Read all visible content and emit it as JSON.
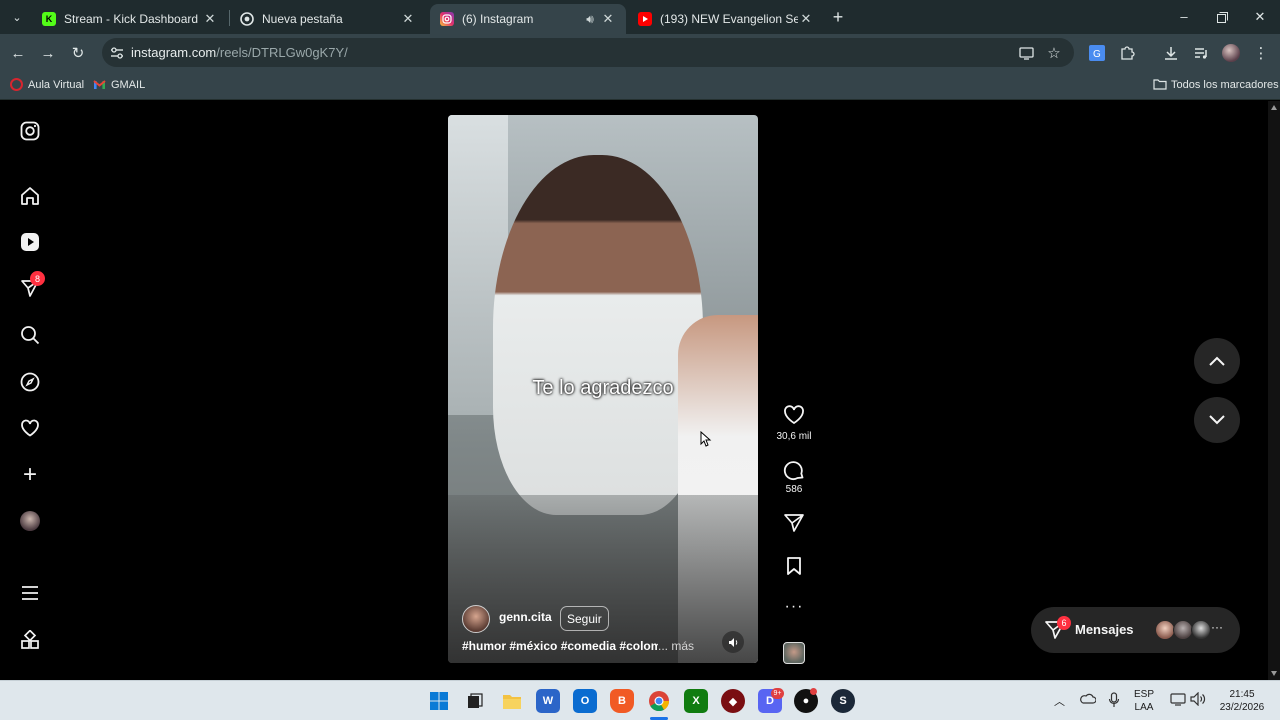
{
  "browser": {
    "tabs": [
      {
        "title": "Stream - Kick Dashboard",
        "favicon": "kick-icon",
        "active": false
      },
      {
        "title": "Nueva pestaña",
        "favicon": "chrome-icon",
        "active": false
      },
      {
        "title": "(6) Instagram",
        "favicon": "instagram-icon",
        "active": true,
        "audio": true
      },
      {
        "title": "(193) NEW Evangelion Series Ar",
        "favicon": "youtube-icon",
        "active": false
      }
    ],
    "url_domain": "instagram.com",
    "url_path": "/reels/DTRLGw0gK7Y/",
    "bookmarks": [
      {
        "label": "Aula Virtual"
      },
      {
        "label": "GMAIL"
      }
    ],
    "all_bookmarks": "Todos los marcadores"
  },
  "instagram": {
    "notifications_badge": "8",
    "reel": {
      "caption_overlay": "Te lo agradezco",
      "username": "genn.cita",
      "follow_label": "Seguir",
      "hashtags": "#humor #méxico #comedia #colomb",
      "more_label": "... más",
      "likes": "30,6 mil",
      "comments": "586"
    },
    "messages": {
      "label": "Mensajes",
      "badge": "6"
    }
  },
  "taskbar": {
    "lang_top": "ESP",
    "lang_bottom": "LAA",
    "time": "21:45",
    "date": "23/2/2026",
    "discord_badge": "9+"
  },
  "colors": {
    "tab_strip": "#1f2b2e",
    "toolbar": "#35444a",
    "notification_red": "#ff3040"
  }
}
